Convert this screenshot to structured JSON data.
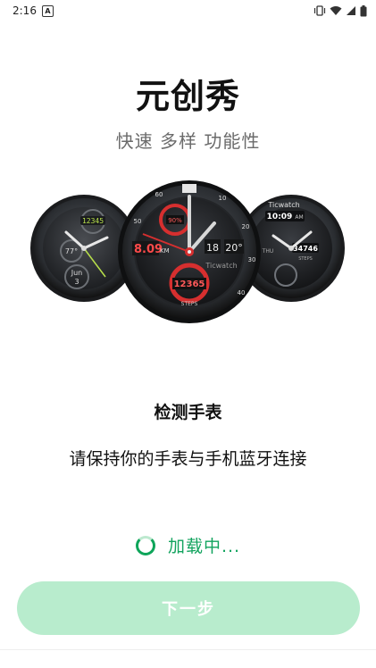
{
  "status_bar": {
    "time": "2:16",
    "notification_icon_letter": "A",
    "icons": [
      "vibrate-icon",
      "wifi-icon",
      "signal-icon",
      "battery-icon"
    ]
  },
  "header": {
    "title": "元创秀",
    "subtitle": "快速 多样 功能性"
  },
  "watch_faces": {
    "left": {
      "steps": "12345",
      "temp": "77°",
      "month": "Jun",
      "day": "3"
    },
    "center": {
      "percent": "90%",
      "distance": "8.09",
      "distance_unit": "KM",
      "temp": "20°",
      "hour": "18",
      "steps": "12365",
      "steps_label": "STEPS",
      "brand": "Ticwatch",
      "bezel_numbers": [
        "10",
        "20",
        "30",
        "40",
        "50",
        "60"
      ]
    },
    "right": {
      "brand": "Ticwatch",
      "time": "10:09",
      "time_suffix": "AM",
      "steps": "34746",
      "steps_label": "STEPS",
      "day_label": "THU"
    }
  },
  "main": {
    "section_title": "检测手表",
    "instruction": "请保持你的手表与手机蓝牙连接",
    "loading_text": "加载中..."
  },
  "footer": {
    "next_label": "下一步"
  },
  "colors": {
    "accent_green": "#12a35e",
    "button_bg": "#b8eccd",
    "watch_red": "#d62f2f"
  }
}
